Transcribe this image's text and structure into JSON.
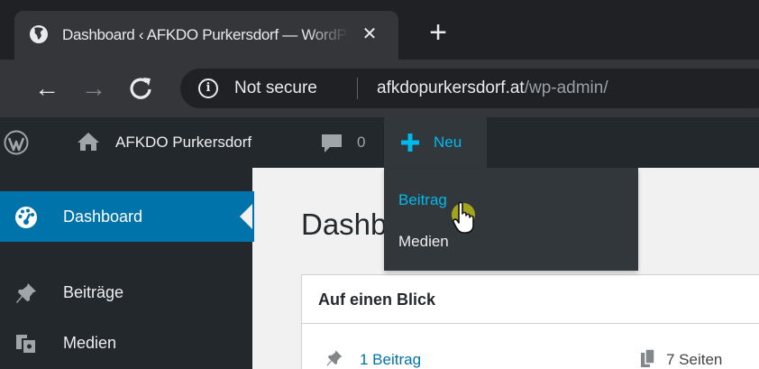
{
  "browser": {
    "tab_title": "Dashboard ‹ AFKDO Purkersdorf — WordPress",
    "tab_close": "✕",
    "new_tab": "+",
    "nav_back": "←",
    "nav_forward": "→",
    "nav_reload": "C",
    "info_glyph": "i",
    "security_label": "Not secure",
    "url_host": "afkdopurkersdorf.at",
    "url_path": "/wp-admin/"
  },
  "adminbar": {
    "site_name": "AFKDO Purkersdorf",
    "comment_count": "0",
    "new_label": "Neu",
    "new_menu_items": [
      "Beitrag",
      "Medien"
    ]
  },
  "sidemenu": {
    "items": [
      {
        "label": "Dashboard",
        "icon": "dashboard-icon",
        "active": true
      },
      {
        "label": "Beiträge",
        "icon": "pin-icon",
        "active": false
      },
      {
        "label": "Medien",
        "icon": "media-icon",
        "active": false
      }
    ]
  },
  "main": {
    "page_title": "Dashboard",
    "glance": {
      "title": "Auf einen Blick",
      "posts": "1 Beitrag",
      "pages": "7 Seiten"
    }
  },
  "colors": {
    "wp_accent": "#0073aa",
    "wp_highlight": "#00b9eb",
    "adminbar_bg": "#23282d",
    "chrome_dark": "#202124",
    "cursor_highlight": "#ffff00"
  }
}
